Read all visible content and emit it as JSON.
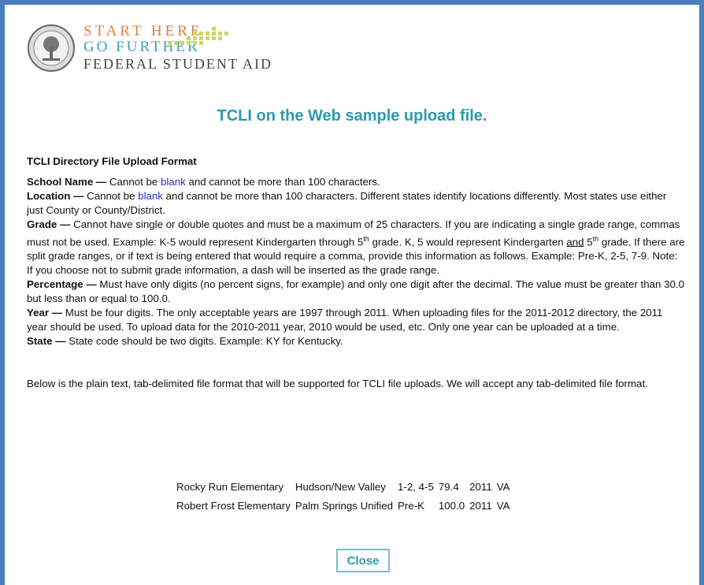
{
  "header": {
    "brand_line1": "START HERE",
    "brand_line2": "GO FURTHER",
    "brand_line3": "FEDERAL STUDENT AID"
  },
  "title": "TCLI on the Web sample upload file.",
  "format_heading": "TCLI Directory File Upload Format",
  "fields": {
    "school_name": {
      "label": "School Name —",
      "pre": " Cannot be ",
      "link": "blank",
      "post": " and cannot be more than 100 characters."
    },
    "location": {
      "label": "Location —",
      "pre": " Cannot be ",
      "link": "blank",
      "post": " and cannot be more than 100 characters. Different states identify locations differently. Most states use either just County or County/District."
    },
    "grade": {
      "label": "Grade —",
      "part1": " Cannot have single or double quotes and must be a maximum of 25 characters. If you are indicating a single grade range, commas must not be used. Example: K-5 would represent Kindergarten through 5",
      "sup1": "th",
      "part2": " grade. K, 5 would represent Kindergarten ",
      "and": "and",
      "part3": " 5",
      "sup2": "th",
      "part4": " grade. If there are split grade ranges, or if text is being entered that would require a comma, provide this information as follows. Example: Pre-K, 2-5, 7-9. Note: If you choose not to submit grade information, a dash will be inserted as the grade range."
    },
    "percentage": {
      "label": "Percentage —",
      "text": " Must have only digits (no percent signs, for example) and only one digit after the decimal. The value must be greater than 30.0 but less than or equal to 100.0."
    },
    "year": {
      "label": "Year —",
      "text": " Must be four digits. The only acceptable years are 1997 through 2011. When uploading files for the 2011-2012 directory, the 2011 year should be used. To upload data for the 2010-2011 year, 2010 would be used, etc. Only one year can be uploaded at a time."
    },
    "state": {
      "label": "State —",
      "text": " State code should be two digits. Example: KY for Kentucky."
    }
  },
  "note": "Below is the plain text, tab-delimited file format that will be supported for TCLI file uploads. We will accept any tab-delimited file format.",
  "sample_rows": [
    [
      "Rocky Run Elementary",
      "Hudson/New Valley",
      "1-2, 4-5",
      "79.4",
      "2011",
      "VA"
    ],
    [
      "Robert Frost Elementary",
      "Palm Springs Unified",
      "Pre-K",
      "100.0",
      "2011",
      "VA"
    ]
  ],
  "close_label": "Close"
}
